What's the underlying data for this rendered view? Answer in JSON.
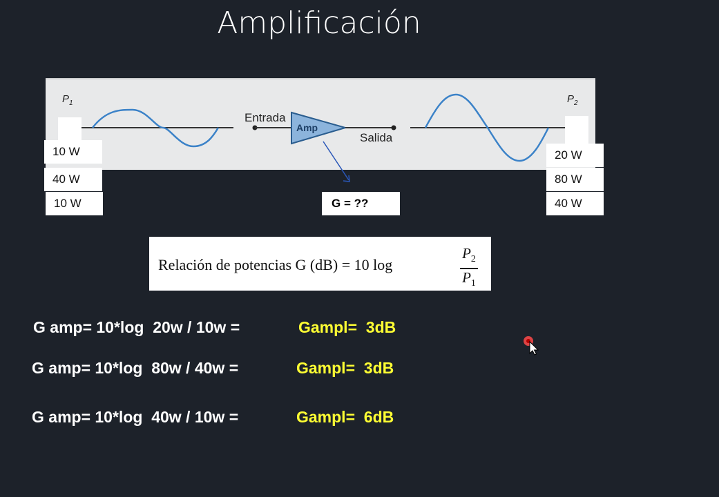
{
  "title": "Amplificación",
  "diagram": {
    "p1_label": "P",
    "p1_sub": "1",
    "p2_label": "P",
    "p2_sub": "2",
    "entrada": "Entrada",
    "amp": "Amp",
    "salida": "Salida",
    "colors": {
      "wave": "#3b82c8",
      "amp_fill": "#8cb4dc"
    }
  },
  "input_powers": [
    "10 W",
    "40 W",
    "10 W"
  ],
  "output_powers": [
    "20 W",
    "80 W",
    "40 W"
  ],
  "gain_box": "G  =  ??",
  "formula": {
    "text": "Relación de potencias  G (dB)  =  10 log",
    "numerator": "P",
    "numerator_sub": "2",
    "denominator": "P",
    "denominator_sub": "1"
  },
  "calculations": [
    {
      "expression": "G amp= 10*log  20w / 10w =",
      "result": "Gampl=  3dB"
    },
    {
      "expression": "G amp= 10*log  80w / 40w =",
      "result": "Gampl=  3dB"
    },
    {
      "expression": "G amp= 10*log  40w / 10w =",
      "result": "Gampl=  6dB"
    }
  ]
}
